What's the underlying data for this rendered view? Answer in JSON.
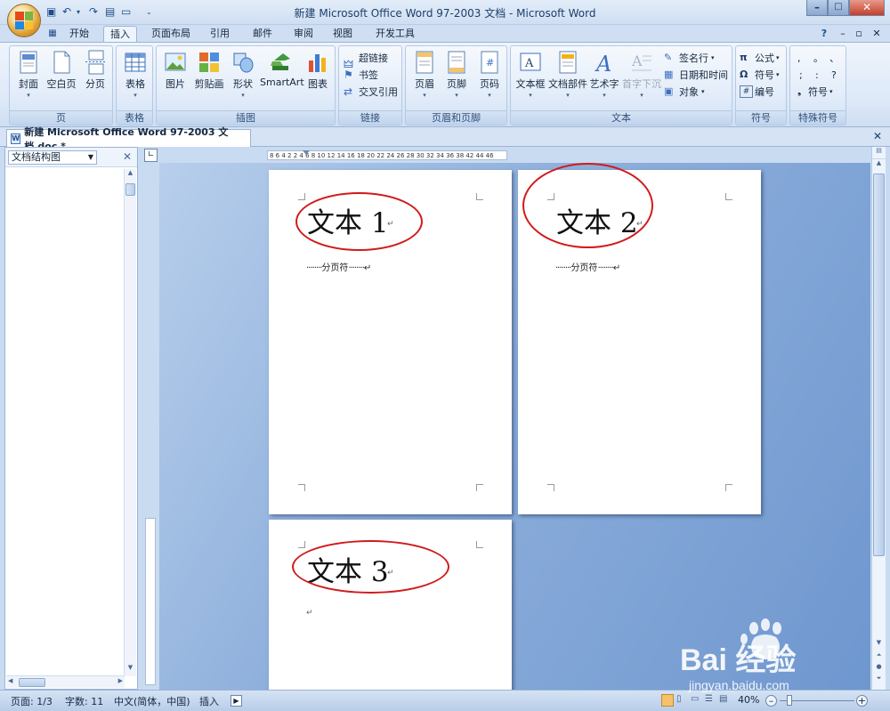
{
  "window": {
    "title": "新建 Microsoft Office Word 97-2003 文档 - Microsoft Word",
    "controls": {
      "minimize": "–",
      "maximize": "□",
      "close": "✕"
    }
  },
  "ribbon": {
    "tabs": [
      {
        "label": "开始"
      },
      {
        "label": "插入"
      },
      {
        "label": "页面布局"
      },
      {
        "label": "引用"
      },
      {
        "label": "邮件"
      },
      {
        "label": "审阅"
      },
      {
        "label": "视图"
      },
      {
        "label": "开发工具"
      }
    ],
    "active_tab": "插入",
    "groups": {
      "pages": {
        "label": "页",
        "buttons": [
          "封面",
          "空白页",
          "分页"
        ]
      },
      "tables": {
        "label": "表格",
        "buttons": [
          "表格"
        ]
      },
      "illustrations": {
        "label": "插图",
        "buttons": [
          "图片",
          "剪贴画",
          "形状",
          "SmartArt",
          "图表"
        ]
      },
      "links": {
        "label": "链接",
        "buttons": [
          "超链接",
          "书签",
          "交叉引用"
        ]
      },
      "header_footer": {
        "label": "页眉和页脚",
        "buttons": [
          "页眉",
          "页脚",
          "页码"
        ]
      },
      "text": {
        "label": "文本",
        "buttons": [
          "文本框",
          "文档部件",
          "艺术字",
          "首字下沉"
        ],
        "small": [
          "签名行",
          "日期和时间",
          "对象"
        ]
      },
      "symbols": {
        "label": "符号",
        "buttons": [
          "公式",
          "符号",
          "编号"
        ]
      },
      "special_symbols": {
        "label": "特殊符号",
        "chars": [
          ",",
          "。",
          "、",
          ";",
          ":",
          "?"
        ],
        "more": "符号"
      }
    }
  },
  "document_tab": {
    "label": "新建 Microsoft Office Word 97-2003 文档.doc *"
  },
  "nav_pane": {
    "dropdown_value": "文档结构图"
  },
  "ruler": {
    "text": "8 6 4 2   2 4 6 8 10 12 14 16 18 20 22 24 26 28 30 32 34 36 38   42 44 46"
  },
  "pages": [
    {
      "text": "文本 1",
      "page_break": "分页符"
    },
    {
      "text": "文本 2",
      "page_break": "分页符"
    },
    {
      "text": "文本 3"
    }
  ],
  "statusbar": {
    "page": "页面: 1/3",
    "words": "字数: 11",
    "language": "中文(简体，中国)",
    "mode": "插入",
    "zoom": "40%"
  },
  "watermark": {
    "text": "Bai 经验",
    "url": "jingyan.baidu.com"
  },
  "colors": {
    "annotation": "#d11b1b",
    "doc_background": "#6f97cf",
    "ribbon": "#dde9f8"
  }
}
